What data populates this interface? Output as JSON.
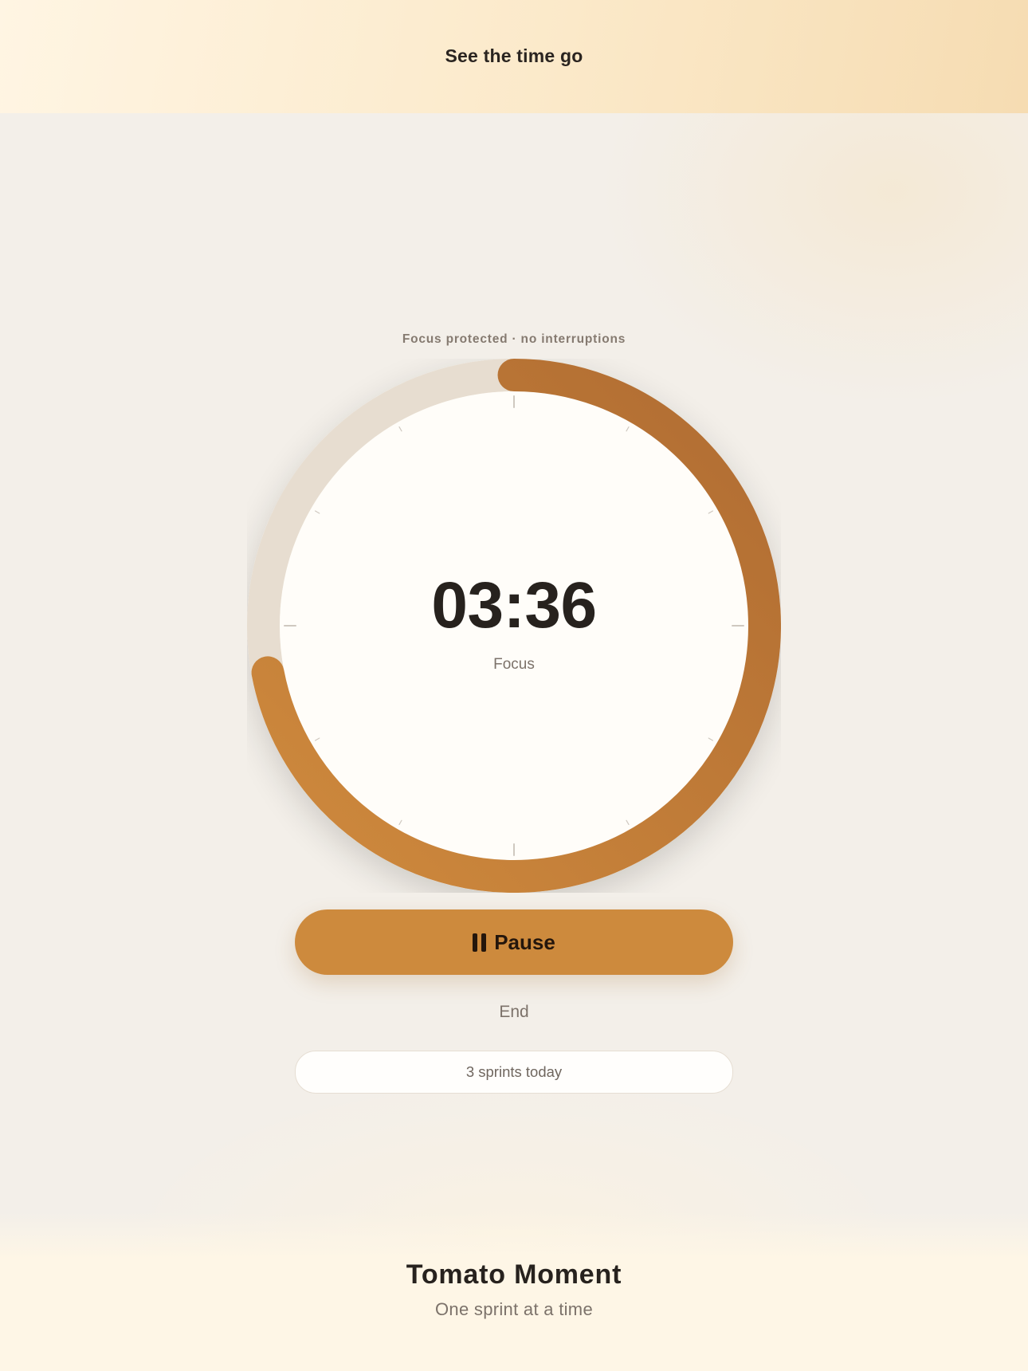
{
  "header": {
    "title": "See the time go"
  },
  "timer": {
    "caption": "Focus protected · no interruptions",
    "time_remaining": "03:36",
    "mode": "Focus",
    "progress_fraction": 0.72,
    "colors": {
      "track": "#e7ddd0",
      "progress_start": "#cf8a3d",
      "progress_end": "#b06c32",
      "face": "#fffdf9",
      "ticks": "#cfc8c0"
    }
  },
  "controls": {
    "pause_label": "Pause",
    "pause_icon": "pause-icon",
    "end_label": "End",
    "accent": "#cd8a3d"
  },
  "stats": {
    "sprints_text": "3 sprints today"
  },
  "footer": {
    "app_name": "Tomato Moment",
    "tagline": "One sprint at a time"
  }
}
